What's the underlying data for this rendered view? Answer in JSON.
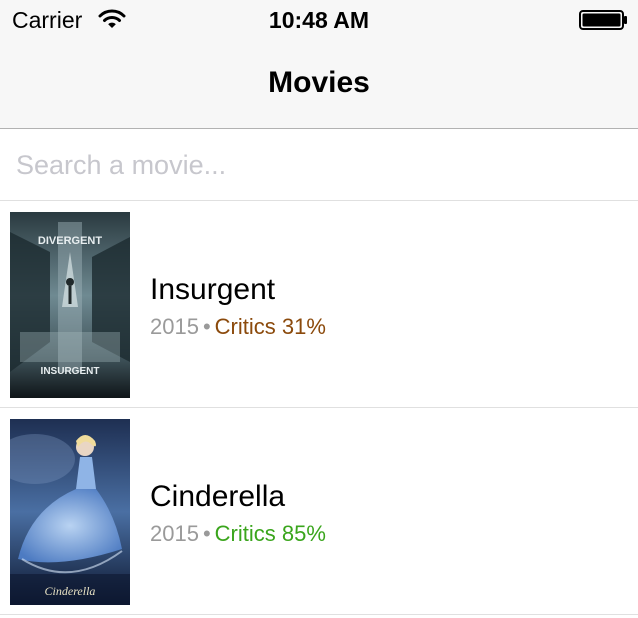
{
  "status_bar": {
    "carrier": "Carrier",
    "time": "10:48 AM",
    "wifi_icon": "wifi-icon",
    "battery_icon": "battery-icon"
  },
  "nav": {
    "title": "Movies"
  },
  "search": {
    "placeholder": "Search a movie...",
    "value": ""
  },
  "movies": [
    {
      "title": "Insurgent",
      "year": "2015",
      "separator": "•",
      "critics": "Critics 31%",
      "critics_color": "#8b4a0c",
      "poster_title": "DIVERGENT",
      "poster_subtitle": "INSURGENT"
    },
    {
      "title": "Cinderella",
      "year": "2015",
      "separator": "•",
      "critics": "Critics 85%",
      "critics_color": "#3aa51c",
      "poster_title": "Cinderella"
    }
  ]
}
